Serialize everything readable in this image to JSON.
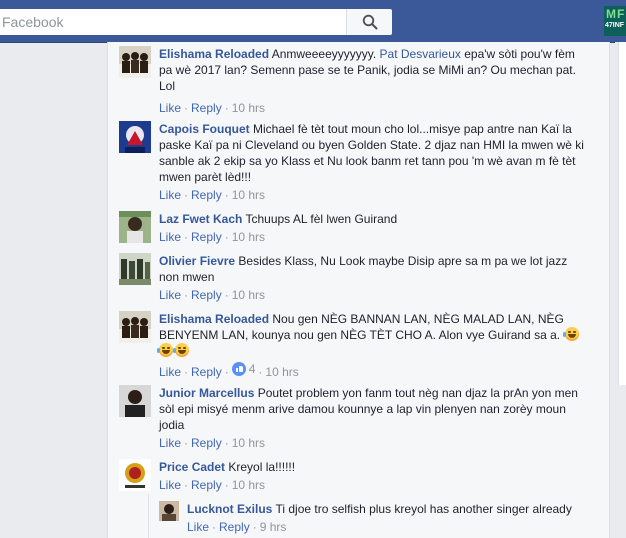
{
  "topbar": {
    "search_placeholder": "Facebook",
    "search_icon": "search-icon",
    "badge_top": "MF",
    "badge_bottom": "47INF"
  },
  "comments": [
    {
      "name": "Elishama Reloaded",
      "text": "Anmweeeeyyyyyyy. Pat Desvarieux epa'w sòti pou'w fèm pa wè 2017 lan? Semenn pase se te Panik, jodia se MiMi an? Ou mechan pat. Lol",
      "mention": "Pat Desvarieux",
      "text_before": "Anmweeeeyyyyyyy. ",
      "text_after": " epa'w sòti pou'w fèm pa wè 2017 lan? Semenn pase se te Panik, jodia se MiMi an? Ou mechan pat. Lol",
      "like": "Like",
      "reply": "Reply",
      "time": "10 hrs"
    },
    {
      "name": "Capois Fouquet",
      "text": "Michael fè tèt tout moun cho lol...misye pap antre nan Kaï la paske Kaï pa ni Cleveland ou byen Golden State. 2 djaz nan HMI la mwen wè ki sanble ak 2 ekip sa yo Klass et Nu look banm ret tann pou 'm wè avan m fè tèt mwen parèt lèd!!!",
      "like": "Like",
      "reply": "Reply",
      "time": "10 hrs"
    },
    {
      "name": "Laz Fwet Kach",
      "text": "Tchuups AL fèl lwen Guirand",
      "like": "Like",
      "reply": "Reply",
      "time": "10 hrs"
    },
    {
      "name": "Olivier Fievre",
      "text": "Besides Klass, Nu Look maybe Disip apre sa m pa we lot jazz non mwen",
      "like": "Like",
      "reply": "Reply",
      "time": "10 hrs"
    },
    {
      "name": "Elishama Reloaded",
      "text": "Nou gen NÈG BANNAN LAN, NÈG MALAD LAN, NÈG BENYENM LAN, kounya nou gen NÈG TÈT CHO A. Alon vye Guirand sa a.",
      "like": "Like",
      "reply": "Reply",
      "reactions": "4",
      "time": "10 hrs"
    },
    {
      "name": "Junior Marcellus",
      "text": "Poutet problem yon fanm tout nèg nan djaz la prAn yon men sòl epi misyé menm arive damou kounnye a lap vin plenyen nan zorèy moun jodia",
      "like": "Like",
      "reply": "Reply",
      "time": "10 hrs"
    },
    {
      "name": "Price Cadet",
      "text": "Kreyol la!!!!!!",
      "like": "Like",
      "reply": "Reply",
      "time": "10 hrs"
    },
    {
      "name": "Lucknot Exilus",
      "text": "Ti djoe tro selfish plus kreyol has another singer already",
      "like": "Like",
      "reply": "Reply",
      "time": "9 hrs"
    }
  ],
  "colors": {
    "brand_blue": "#3b5998",
    "name_blue": "#365899",
    "link_blue": "#4267b2",
    "meta_gray": "#90949c"
  }
}
